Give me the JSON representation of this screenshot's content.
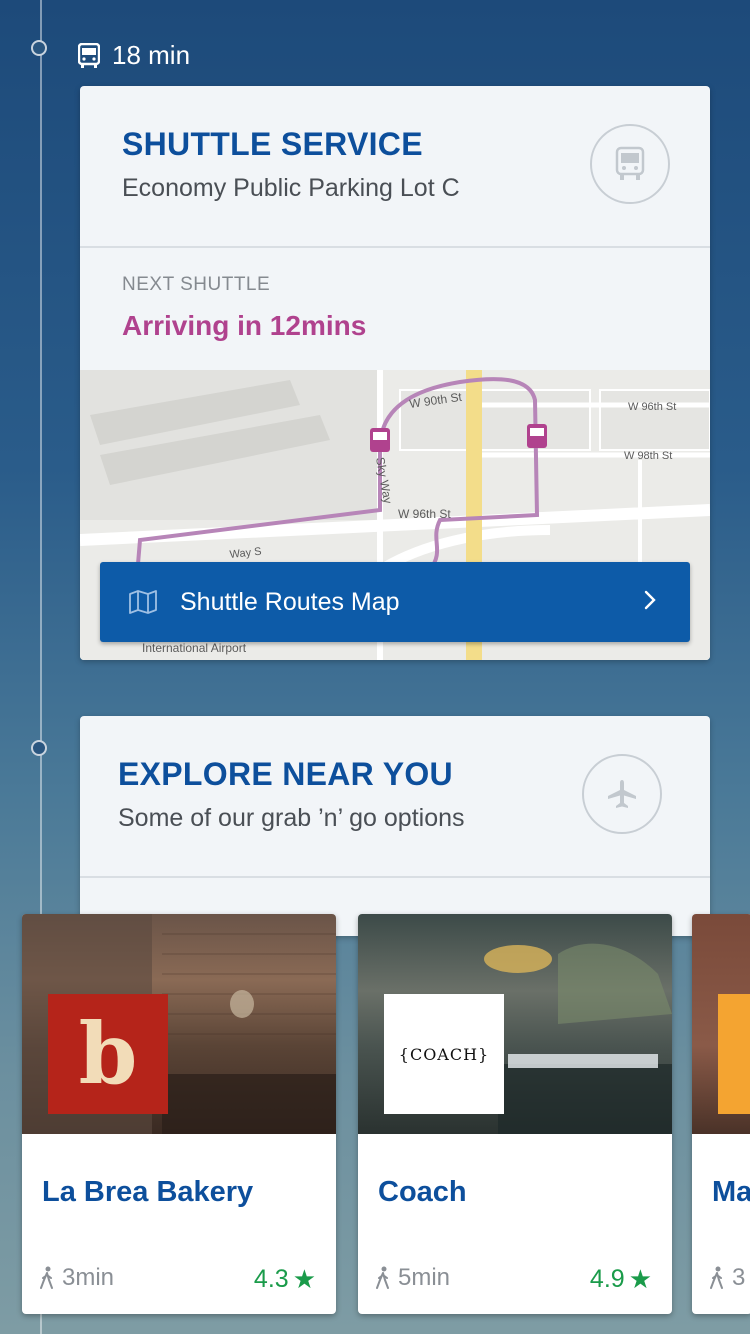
{
  "timeline": {
    "step1": {
      "icon": "bus-icon",
      "duration": "18 min"
    }
  },
  "shuttle_card": {
    "title": "SHUTTLE SERVICE",
    "subtitle": "Economy Public Parking Lot C",
    "icon": "bus-icon",
    "next_label": "NEXT SHUTTLE",
    "next_value": "Arriving in 12mins",
    "map_labels": {
      "street1": "W 90th St",
      "street2": "W 96th St",
      "street3": "W 98th St",
      "street4": "W 96th St",
      "street5": "Sky Way",
      "street6": "Way S",
      "street7": "International Airport"
    },
    "routes_button": "Shuttle Routes Map"
  },
  "explore_card": {
    "title": "EXPLORE NEAR YOU",
    "subtitle": "Some of our grab ’n’ go options",
    "icon": "airplane-icon"
  },
  "places": [
    {
      "name": "La Brea Bakery",
      "walk": "3min",
      "rating": "4.3",
      "logo": "b"
    },
    {
      "name": "Coach",
      "walk": "5min",
      "rating": "4.9",
      "logo": "COACH"
    },
    {
      "name": "Ma",
      "walk": "3",
      "rating": "",
      "logo": ""
    }
  ],
  "colors": {
    "accent": "#0d4f9c",
    "highlight": "#b0428e",
    "rating": "#1a9b4a"
  }
}
